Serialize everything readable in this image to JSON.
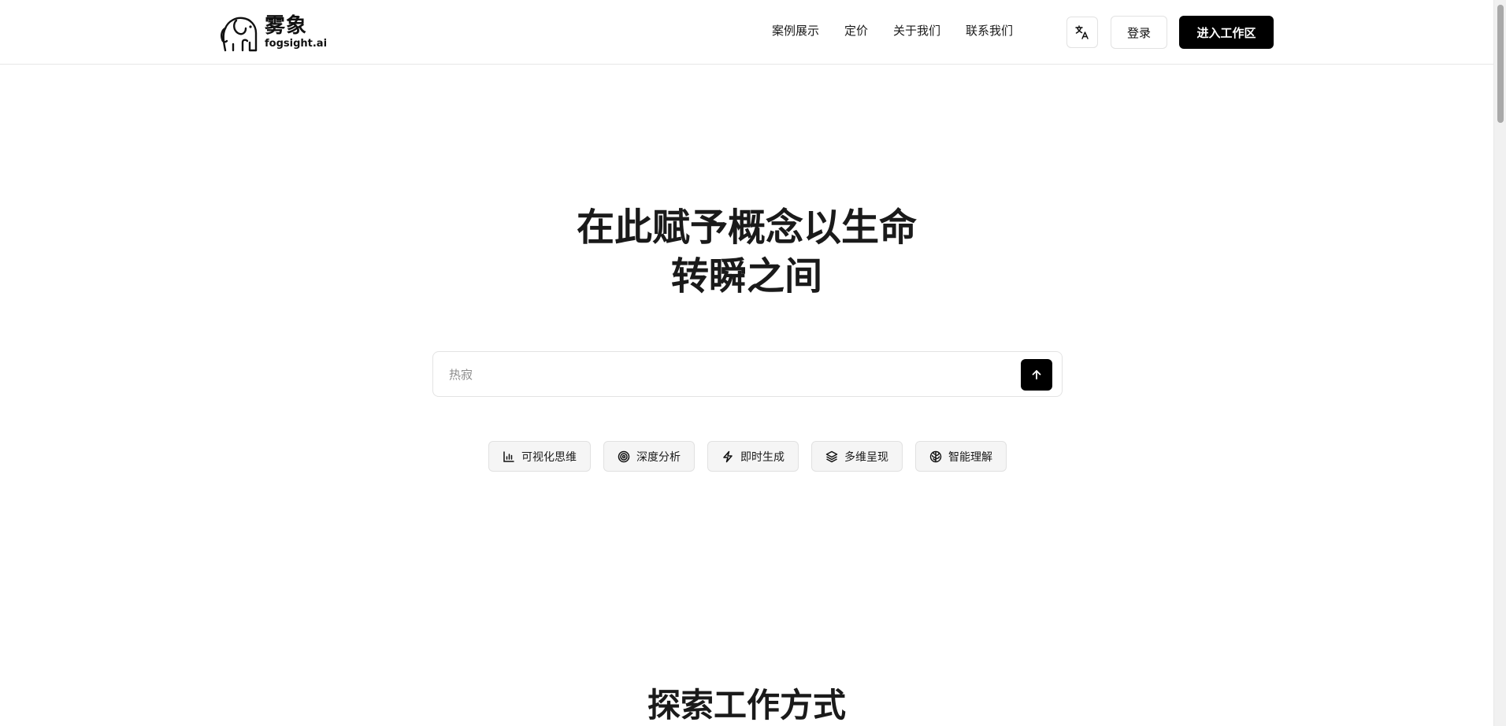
{
  "brand": {
    "name_cn": "雾象",
    "name_en": "fogsight.ai"
  },
  "nav": {
    "items": [
      {
        "label": "案例展示"
      },
      {
        "label": "定价"
      },
      {
        "label": "关于我们"
      },
      {
        "label": "联系我们"
      }
    ],
    "login_label": "登录",
    "workspace_label": "进入工作区",
    "language_icon": "translate-icon"
  },
  "hero": {
    "title_line1": "在此赋予概念以生命",
    "title_line2": "转瞬之间"
  },
  "search": {
    "placeholder": "热寂",
    "value": "",
    "submit_icon": "arrow-up-icon"
  },
  "features": [
    {
      "label": "可视化思维",
      "icon": "bar-chart-icon"
    },
    {
      "label": "深度分析",
      "icon": "target-icon"
    },
    {
      "label": "即时生成",
      "icon": "lightning-icon"
    },
    {
      "label": "多维呈现",
      "icon": "layers-icon"
    },
    {
      "label": "智能理解",
      "icon": "brain-icon"
    }
  ],
  "section": {
    "title": "探索工作方式"
  },
  "colors": {
    "primary": "#000000",
    "background": "#ffffff",
    "chip_bg": "#f5f5f5",
    "border": "#e3e3e3"
  }
}
